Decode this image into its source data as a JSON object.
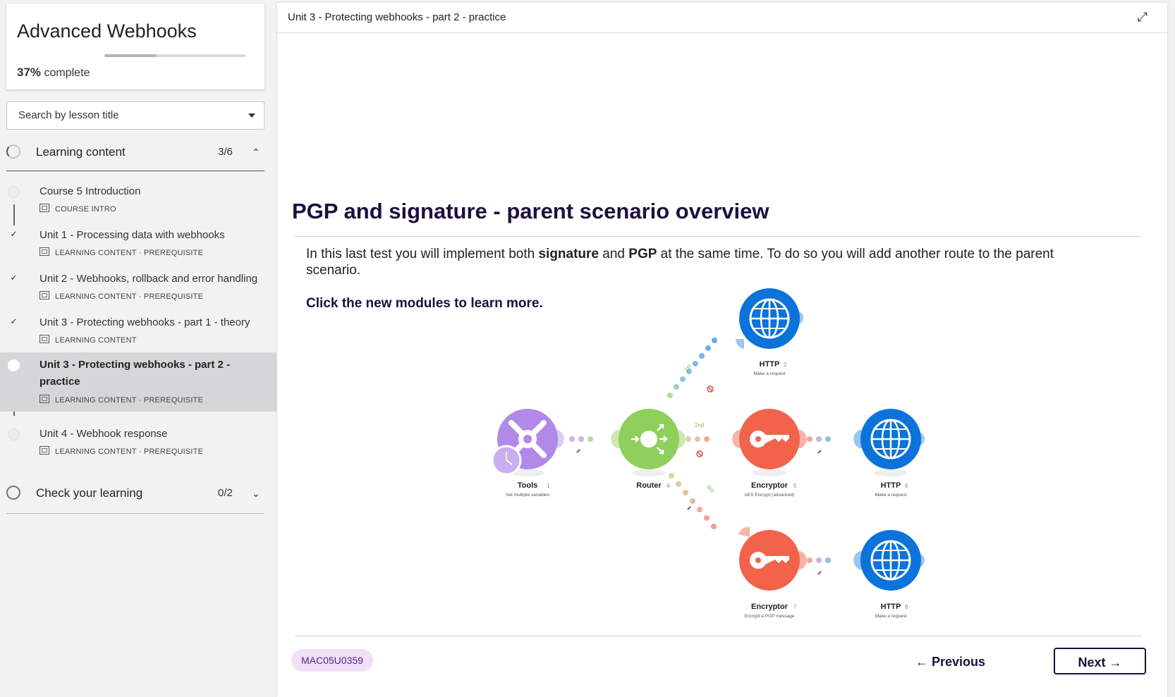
{
  "sidebar": {
    "course_title": "Advanced Webhooks",
    "progress_percent": 37,
    "progress_value": "37%",
    "progress_suffix": "complete",
    "search_placeholder": "Search by lesson title",
    "sections": [
      {
        "title": "Learning content",
        "count": "3/6",
        "expanded": true
      },
      {
        "title": "Check your learning",
        "count": "0/2",
        "expanded": false
      }
    ],
    "lessons": [
      {
        "title": "Course 5 Introduction",
        "meta": "COURSE INTRO",
        "status": "not-started"
      },
      {
        "title": "Unit 1 - Processing data with webhooks",
        "meta": "LEARNING CONTENT · PREREQUISITE",
        "status": "done"
      },
      {
        "title": "Unit 2 - Webhooks, rollback and error handling",
        "meta": "LEARNING CONTENT · PREREQUISITE",
        "status": "done"
      },
      {
        "title": "Unit 3 - Protecting webhooks - part 1 - theory",
        "meta": "LEARNING CONTENT",
        "status": "done"
      },
      {
        "title": "Unit 3 - Protecting webhooks - part 2 - practice",
        "meta": "LEARNING CONTENT · PREREQUISITE",
        "status": "current"
      },
      {
        "title": "Unit 4 - Webhook response",
        "meta": "LEARNING CONTENT · PREREQUISITE",
        "status": "not-started"
      }
    ]
  },
  "main": {
    "topbar_title": "Unit 3 - Protecting webhooks - part 2 - practice",
    "heading": "PGP and signature - parent scenario overview",
    "paragraph": {
      "part1": "In this last test you will implement both ",
      "bold1": "signature",
      "part2": " and ",
      "bold2": "PGP",
      "part3": " at the same time. To do so you will add another route to the parent scenario."
    },
    "cta": "Click the new modules to learn more.",
    "diagram": {
      "modules": [
        {
          "name": "Tools",
          "num": "1",
          "sub": "Set multiple variables",
          "color": "#b189e8"
        },
        {
          "name": "Router",
          "num": "4",
          "sub": "",
          "color": "#8fcf5c"
        },
        {
          "name": "HTTP",
          "num": "2",
          "sub": "Make a request",
          "color": "#0b73d9"
        },
        {
          "name": "Encryptor",
          "num": "5",
          "sub": "AES Encrypt (advanced)",
          "color": "#f2634c"
        },
        {
          "name": "HTTP",
          "num": "6",
          "sub": "Make a request",
          "color": "#0b73d9"
        },
        {
          "name": "Encryptor",
          "num": "7",
          "sub": "Encrypt a PGP message",
          "color": "#f2634c"
        },
        {
          "name": "HTTP",
          "num": "8",
          "sub": "Make a request",
          "color": "#0b73d9"
        }
      ],
      "route_labels": [
        "1st",
        "2nd",
        "3rd"
      ]
    },
    "badge": "MAC05U0359",
    "prev_label": "← Previous",
    "next_label": "Next →"
  }
}
